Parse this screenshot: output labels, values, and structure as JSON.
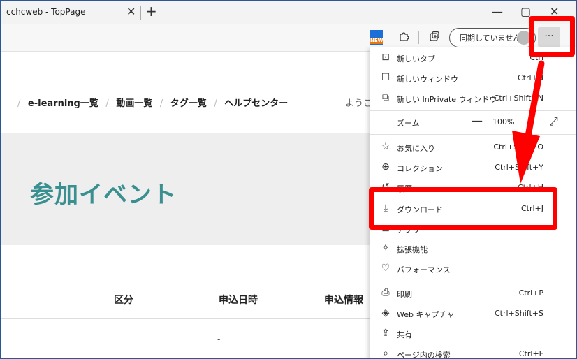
{
  "tab": {
    "title": "cchcweb - TopPage",
    "close": "✕",
    "new_tab": "+"
  },
  "window": {
    "minimize": "—",
    "maximize": "▢",
    "close": "✕"
  },
  "toolbar": {
    "new_badge": "NEW",
    "sync_label": "同期していません",
    "more_label": "···"
  },
  "breadcrumbs": [
    "e-learning一覧",
    "動画一覧",
    "タグ一覧",
    "ヘルプセンター"
  ],
  "breadcrumb_sep": "/",
  "welcome": "ようこ",
  "hero_title": "参加イベント",
  "table": {
    "headers": [
      "区分",
      "申込日時",
      "申込情報"
    ],
    "row1_value": "-"
  },
  "menu": {
    "items": [
      {
        "icon": "new-tab-icon",
        "glyph": "⊡",
        "label": "新しいタブ",
        "shortcut": "Ctrl"
      },
      {
        "icon": "new-window-icon",
        "glyph": "☐",
        "label": "新しいウィンドウ",
        "shortcut": "Ctrl+N"
      },
      {
        "icon": "inprivate-icon",
        "glyph": "⧉",
        "label": "新しい InPrivate ウィンドウ",
        "shortcut": "Ctrl+Shift+N"
      }
    ],
    "zoom": {
      "label": "ズーム",
      "minus": "—",
      "value": "100%",
      "expand": "⤢"
    },
    "items2": [
      {
        "icon": "favorites-icon",
        "glyph": "☆",
        "label": "お気に入り",
        "shortcut": "Ctrl+Shift+O"
      },
      {
        "icon": "collections-icon",
        "glyph": "⊕",
        "label": "コレクション",
        "shortcut": "Ctrl+Shift+Y"
      },
      {
        "icon": "history-icon",
        "glyph": "↺",
        "label": "履歴",
        "shortcut": "Ctrl+H"
      },
      {
        "icon": "download-icon",
        "glyph": "⤓",
        "label": "ダウンロード",
        "shortcut": "Ctrl+J"
      },
      {
        "icon": "apps-icon",
        "glyph": "⊞",
        "label": "アプリ",
        "shortcut": ""
      },
      {
        "icon": "extensions-icon",
        "glyph": "✧",
        "label": "拡張機能",
        "shortcut": ""
      },
      {
        "icon": "performance-icon",
        "glyph": "♡",
        "label": "パフォーマンス",
        "shortcut": ""
      }
    ],
    "items3": [
      {
        "icon": "print-icon",
        "glyph": "⎙",
        "label": "印刷",
        "shortcut": "Ctrl+P"
      },
      {
        "icon": "web-capture-icon",
        "glyph": "◈",
        "label": "Web キャプチャ",
        "shortcut": "Ctrl+Shift+S"
      },
      {
        "icon": "share-icon",
        "glyph": "⇪",
        "label": "共有",
        "shortcut": ""
      },
      {
        "icon": "find-icon",
        "glyph": "⌕",
        "label": "ページ内の検索",
        "shortcut": "Ctrl+F"
      }
    ]
  },
  "annotation_color": "#ff0000",
  "accent_color": "#3a8f91"
}
